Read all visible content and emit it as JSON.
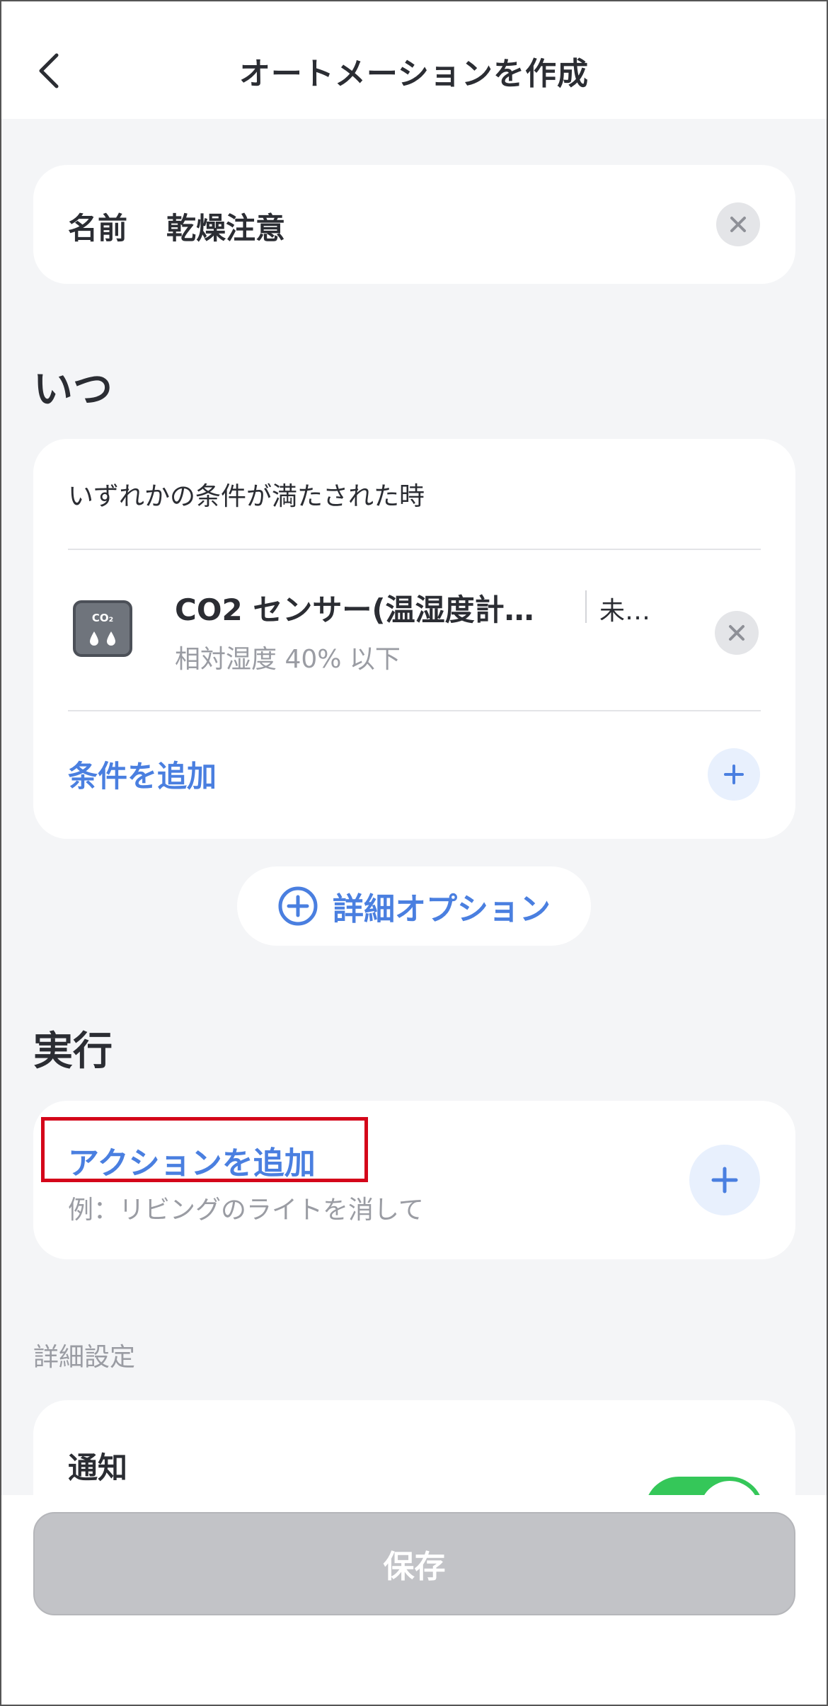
{
  "header": {
    "title": "オートメーションを作成"
  },
  "name": {
    "label": "名前",
    "value": "乾燥注意"
  },
  "when": {
    "section_title": "いつ",
    "mode": "いずれかの条件が満たされた時",
    "condition": {
      "device_name": "CO2 センサー(温湿度計…",
      "room": "未…",
      "rule": "相対湿度 40% 以下"
    },
    "add_condition": "条件を追加"
  },
  "detail_options": "詳細オプション",
  "execute": {
    "section_title": "実行",
    "add_action": "アクションを追加",
    "example": "例：リビングのライトを消して"
  },
  "advanced": {
    "label": "詳細設定",
    "notify_label": "通知",
    "notify_enabled": true
  },
  "save_label": "保存",
  "colors": {
    "accent": "#4a7fe0",
    "toggle_on": "#35c759",
    "highlight": "#d4061a",
    "save_disabled": "#c2c3c7"
  }
}
